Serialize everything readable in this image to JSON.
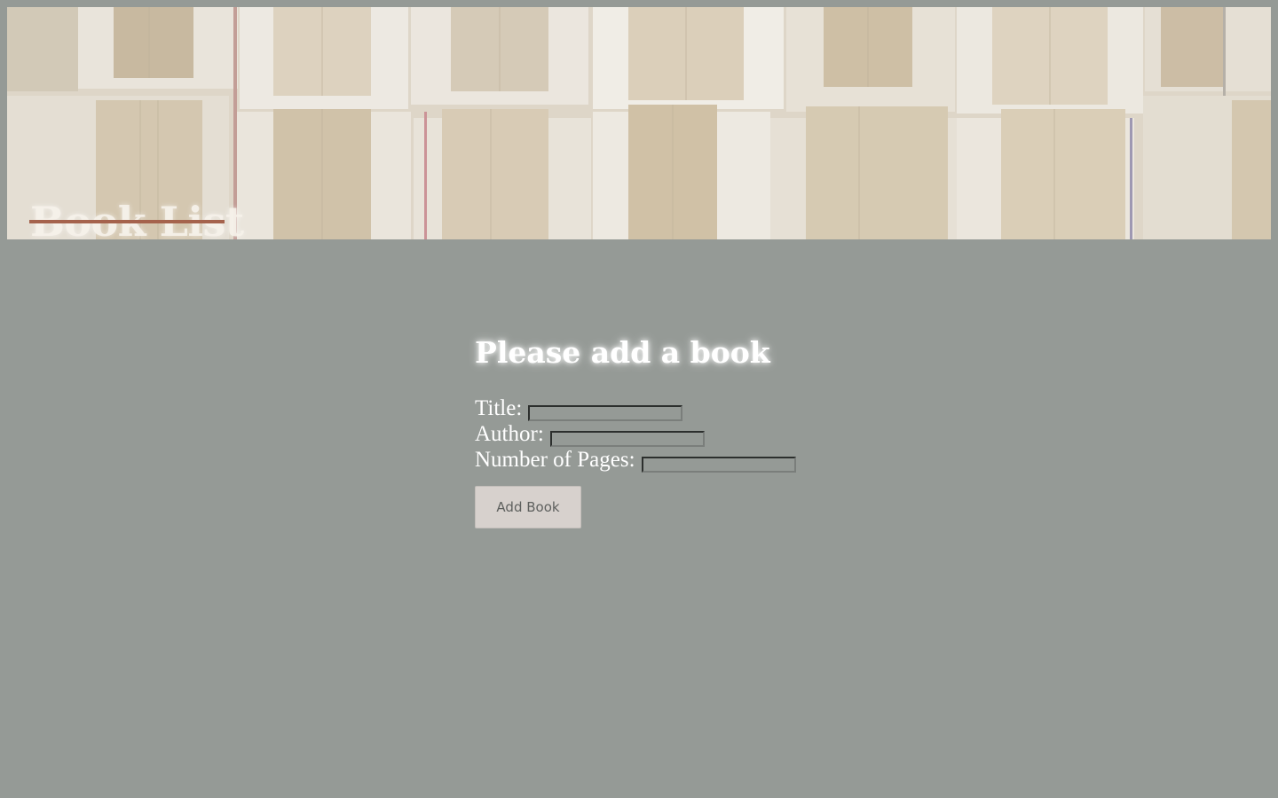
{
  "header": {
    "title": "Book List",
    "accent_color": "#a5634d"
  },
  "form": {
    "heading": "Please add a book",
    "fields": [
      {
        "label": "Title:",
        "value": "",
        "placeholder": ""
      },
      {
        "label": "Author:",
        "value": "",
        "placeholder": ""
      },
      {
        "label": "Number of Pages:",
        "value": "",
        "placeholder": ""
      }
    ],
    "submit_label": "Add Book"
  },
  "colors": {
    "page_background": "#959a96",
    "button_background": "#d7d1cd",
    "heading_text": "#ffffff"
  }
}
